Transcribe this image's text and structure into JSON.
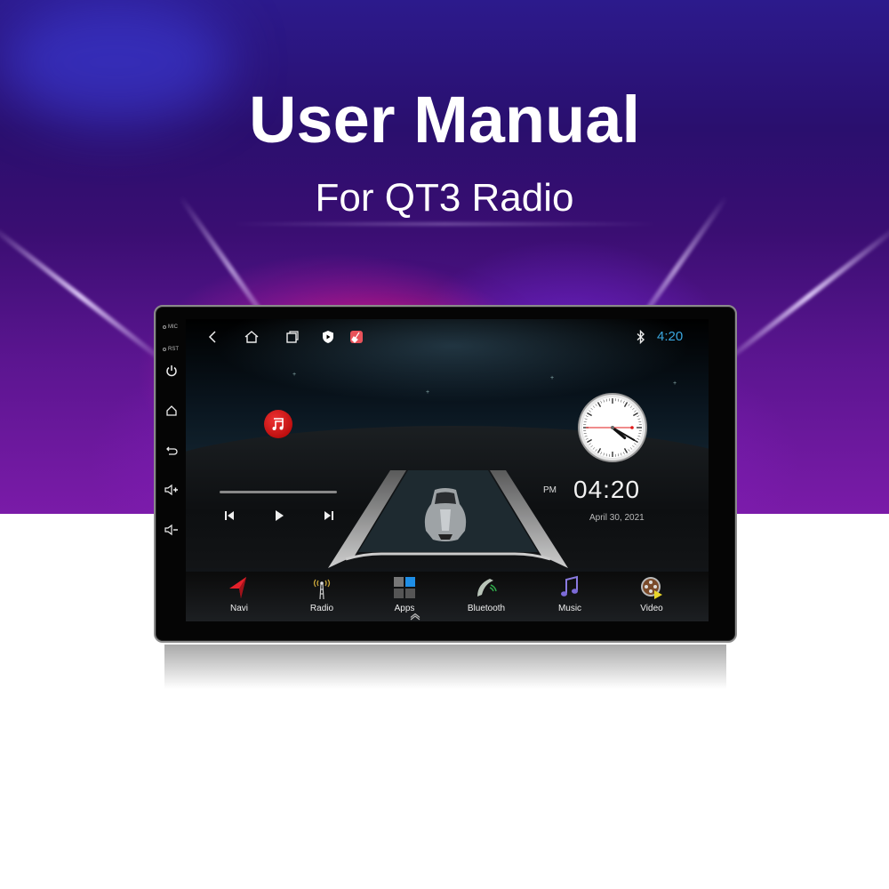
{
  "page": {
    "title": "User Manual",
    "subtitle": "For QT3 Radio"
  },
  "device": {
    "side_labels": [
      "MIC",
      "RST"
    ],
    "side_buttons": [
      {
        "name": "power",
        "icon": "power-icon"
      },
      {
        "name": "home",
        "icon": "home-icon"
      },
      {
        "name": "back",
        "icon": "back-icon"
      },
      {
        "name": "volume-up",
        "icon": "volume-up-icon"
      },
      {
        "name": "volume-down",
        "icon": "volume-down-icon"
      }
    ]
  },
  "statusbar": {
    "nav_icons": [
      "back-icon",
      "home-icon",
      "recents-icon",
      "shield-play-icon",
      "cleaner-app-icon"
    ],
    "bluetooth_icon": "bluetooth-icon",
    "time": "4:20",
    "time_color": "#3aa7e0"
  },
  "media_widget": {
    "badge_icon": "music-note-icon",
    "badge_color": "#d61f1f",
    "progress": 0.0,
    "controls": [
      "previous-icon",
      "play-icon",
      "next-icon"
    ]
  },
  "clock_widget": {
    "analog_time": "4:20",
    "ampm": "PM",
    "digital_time": "04:20",
    "date": "April 30, 2021"
  },
  "dock": {
    "items": [
      {
        "label": "Navi",
        "icon": "navigation-arrow-icon"
      },
      {
        "label": "Radio",
        "icon": "radio-antenna-icon"
      },
      {
        "label": "Apps",
        "icon": "apps-grid-icon"
      },
      {
        "label": "Bluetooth",
        "icon": "phone-handset-icon"
      },
      {
        "label": "Music",
        "icon": "music-note-icon"
      },
      {
        "label": "Video",
        "icon": "film-reel-icon"
      }
    ],
    "drawer_icon": "chevron-up-double-icon"
  }
}
